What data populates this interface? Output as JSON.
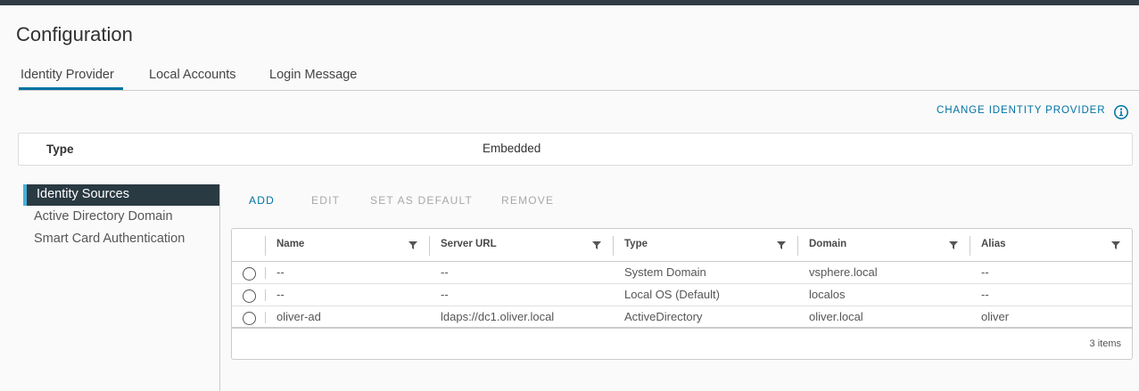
{
  "page": {
    "title": "Configuration"
  },
  "tabs": [
    {
      "label": "Identity Provider",
      "active": true
    },
    {
      "label": "Local Accounts",
      "active": false
    },
    {
      "label": "Login Message",
      "active": false
    }
  ],
  "header_actions": {
    "change_provider": "CHANGE IDENTITY PROVIDER",
    "info_icon": "info-circle-icon"
  },
  "provider": {
    "type_label": "Type",
    "type_value": "Embedded"
  },
  "left_nav": [
    {
      "label": "Identity Sources",
      "active": true
    },
    {
      "label": "Active Directory Domain",
      "active": false
    },
    {
      "label": "Smart Card Authentication",
      "active": false
    }
  ],
  "actions": {
    "add": "ADD",
    "edit": "EDIT",
    "set_default": "SET AS DEFAULT",
    "remove": "REMOVE"
  },
  "grid": {
    "columns": [
      "Name",
      "Server URL",
      "Type",
      "Domain",
      "Alias"
    ],
    "rows": [
      {
        "name": "--",
        "server_url": "--",
        "type": "System Domain",
        "domain": "vsphere.local",
        "alias": "--"
      },
      {
        "name": "--",
        "server_url": "--",
        "type": "Local OS (Default)",
        "domain": "localos",
        "alias": "--"
      },
      {
        "name": "oliver-ad",
        "server_url": "ldaps://dc1.oliver.local",
        "type": "ActiveDirectory",
        "domain": "oliver.local",
        "alias": "oliver"
      }
    ],
    "footer": "3 items"
  },
  "colors": {
    "accent": "#0072a3",
    "nav_active_bg": "#2a3a42",
    "nav_active_bar": "#49afd9",
    "topbar": "#313c45"
  }
}
